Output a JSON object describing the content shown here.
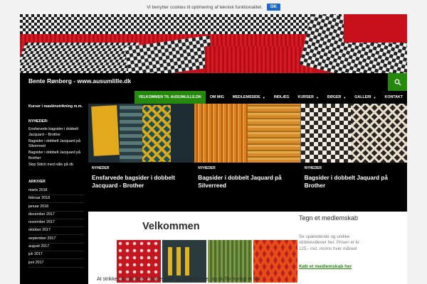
{
  "cookie": {
    "text": "Vi benytter cookies til optimering af teknisk funktionalitet.",
    "ok_label": "OK"
  },
  "site": {
    "title": "Bente Rønberg - www.ausumlille.dk"
  },
  "nav": {
    "items": [
      {
        "label": "VELKOMMEN TIL AUSUMLILLE.DK",
        "active": true,
        "dropdown": false
      },
      {
        "label": "OM MIG",
        "active": false,
        "dropdown": false
      },
      {
        "label": "MEDLEMSSIDE",
        "active": false,
        "dropdown": true
      },
      {
        "label": "INDLÆG",
        "active": false,
        "dropdown": false
      },
      {
        "label": "KURSER",
        "active": false,
        "dropdown": true
      },
      {
        "label": "BØGER",
        "active": false,
        "dropdown": true
      },
      {
        "label": "GALLERI",
        "active": false,
        "dropdown": true
      },
      {
        "label": "KONTAKT",
        "active": false,
        "dropdown": false
      }
    ]
  },
  "sidebar": {
    "kurser_title": "Kurser i maskinstrikning m.m.",
    "news_heading": "NYHEDER:",
    "news": [
      "Ensfarvede bagsider i dobbelt Jacquard – Brother",
      "Bagsider i dobbelt Jacquard på Silverreed",
      "Bagsider i dobbelt Jacquard på Brother",
      "Skip Stitch med nåle på rib"
    ],
    "archive_heading": "ARKIVER",
    "archive": [
      "marts 2018",
      "februar 2018",
      "januar 2018",
      "december 2017",
      "november 2017",
      "oktober 2017",
      "september 2017",
      "august 2017",
      "juli 2017",
      "juni 2017"
    ]
  },
  "featured": [
    {
      "category": "NYHEDER",
      "title": "Ensfarvede bagsider i dobbelt Jacquard - Brother"
    },
    {
      "category": "NYHEDER",
      "title": "Bagsider i dobbelt Jaquard på Silverreed"
    },
    {
      "category": "NYHEDER",
      "title": "Bagsider i dobbelt Jaquard på Brother"
    }
  ],
  "main": {
    "title": "Velkommen",
    "intro": "At strikke på maskine er både sjovt og spændende, og du får hurtigt et flot"
  },
  "membership": {
    "title": "Tegn et medlemskab",
    "text": "Se spændende og unikke strikkevideoer her. Prisen er kr. 125,- incl. moms hver måned",
    "link": "Køb et medlemskab her"
  },
  "colors": {
    "accent": "#24890d",
    "cookie_button": "#1b6ac9"
  },
  "icons": {
    "search": "search-icon",
    "dropdown": "caret-down-icon"
  }
}
